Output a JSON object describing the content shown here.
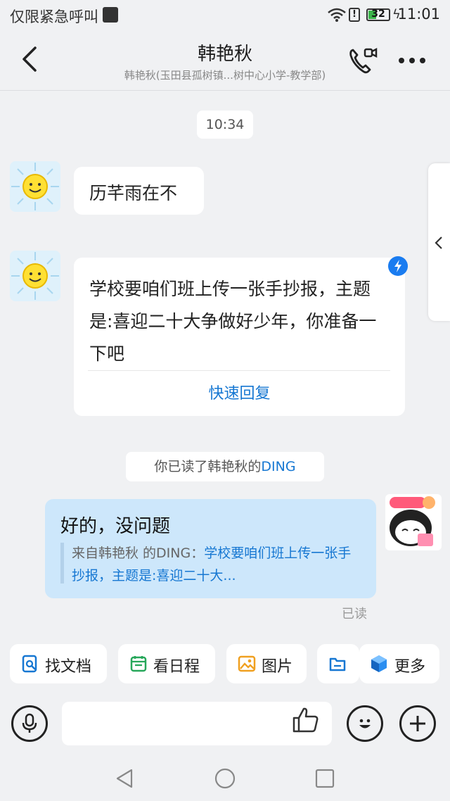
{
  "status_bar": {
    "carrier": "仅限紧急呼叫",
    "battery": "32",
    "time": "11:01"
  },
  "header": {
    "title": "韩艳秋",
    "subtitle": "韩艳秋(玉田县孤树镇...树中心小学-教学部)"
  },
  "chat": {
    "time_label": "10:34",
    "messages": [
      {
        "text": "历芊雨在不"
      },
      {
        "text": "学校要咱们班上传一张手抄报，主题是:喜迎二十大争做好少年，你准备一下吧",
        "action": "快速回复"
      }
    ],
    "ding_notice": {
      "prefix": "你已读了韩艳秋的",
      "ding": "DING"
    },
    "reply": {
      "text": "好的，没问题",
      "quote_prefix": "来自韩艳秋 的DING：",
      "quote_link": "学校要咱们班上传一张手抄报，主题是:喜迎二十大...",
      "status": "已读"
    }
  },
  "quick_tools": {
    "docs": "找文档",
    "calendar": "看日程",
    "image": "图片",
    "more": "更多"
  },
  "input": {
    "placeholder": ""
  },
  "colors": {
    "accent": "#1677d2",
    "my_bubble": "#cde7fb",
    "background": "#f0f1f3"
  }
}
